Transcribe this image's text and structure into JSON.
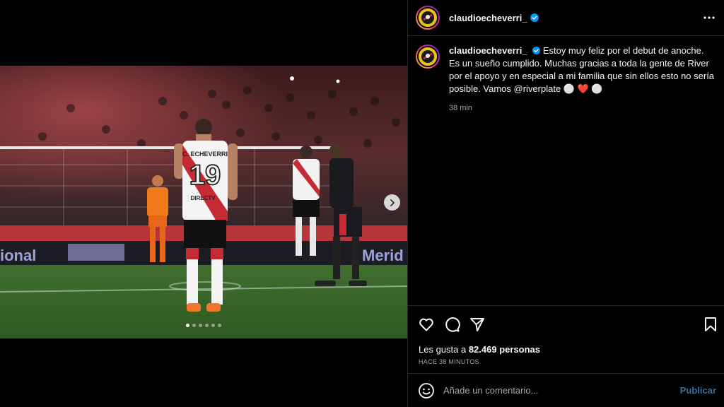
{
  "post": {
    "username": "claudioecheverri_",
    "caption": "Estoy muy feliz por el debut de anoche. Es un sueño cumplido. Muchas gracias a toda la gente de River por el apoyo y en especial a mi familia que sin ellos esto no sería posible. Vamos @riverplate ⚪ ❤️ ⚪",
    "caption_time": "38 min",
    "likes_prefix": "Les gusta a ",
    "likes_count": "82.469 personas",
    "date_label": "HACE 38 MINUTOS",
    "carousel_count": 6,
    "carousel_active_index": 0
  },
  "photo_text": {
    "shirt_name": "C. ECHEVERRI",
    "shirt_number": "19",
    "sponsor": "DIRECTV",
    "board_left": "ional",
    "board_right": "Merid"
  },
  "comment": {
    "placeholder": "Añade un comentario...",
    "publish_label": "Publicar"
  },
  "icons": {
    "more": "more-options-icon",
    "like": "heart-icon",
    "comment": "comment-icon",
    "share": "send-icon",
    "save": "bookmark-icon",
    "emoji": "emoji-icon",
    "next": "chevron-right-icon",
    "verified": "verified-badge-icon"
  },
  "colors": {
    "background": "#000000",
    "divider": "#262626",
    "text_primary": "#f5f5f5",
    "text_secondary": "#a8a8a8",
    "verified_blue": "#0095f6",
    "publish_link": "#3b6f9c"
  }
}
